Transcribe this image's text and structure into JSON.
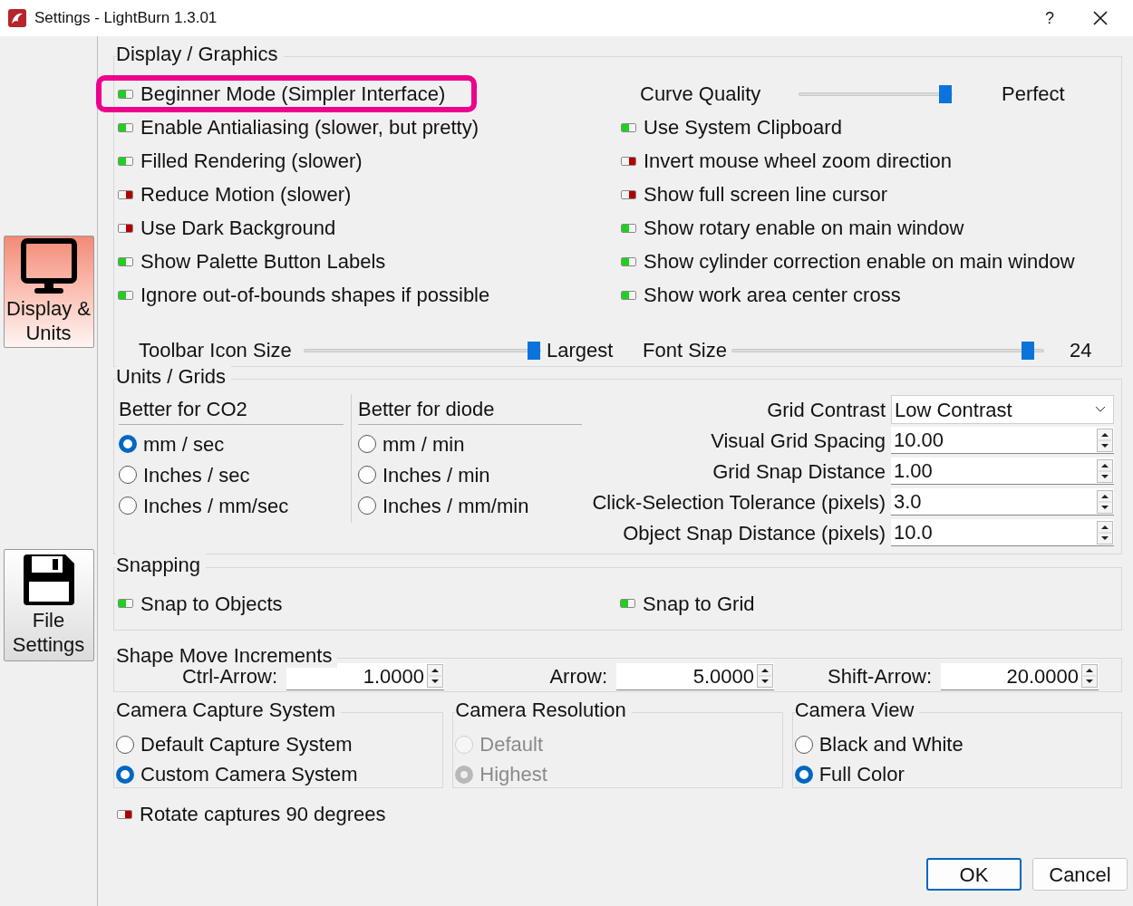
{
  "window": {
    "title": "Settings - LightBurn 1.3.01",
    "help": "?"
  },
  "sidebar": [
    {
      "label": "Display & Units",
      "selected": true
    },
    {
      "label": "File Settings",
      "selected": false
    }
  ],
  "display": {
    "title": "Display / Graphics",
    "left_toggles": [
      {
        "label": "Beginner Mode (Simpler Interface)",
        "on": true,
        "highlighted": true
      },
      {
        "label": "Enable Antialiasing (slower, but pretty)",
        "on": true,
        "highlighted": false
      },
      {
        "label": "Filled Rendering (slower)",
        "on": true,
        "highlighted": false
      },
      {
        "label": "Reduce Motion (slower)",
        "on": false,
        "highlighted": false
      },
      {
        "label": "Use Dark Background",
        "on": false,
        "highlighted": false
      },
      {
        "label": "Show Palette Button Labels",
        "on": true,
        "highlighted": false
      },
      {
        "label": "Ignore out-of-bounds shapes if possible",
        "on": true,
        "highlighted": false
      }
    ],
    "curve_quality": {
      "label": "Curve Quality",
      "level": 1,
      "reading": "Perfect"
    },
    "right_toggles": [
      {
        "label": "Use System Clipboard",
        "on": true
      },
      {
        "label": "Invert mouse wheel zoom direction",
        "on": false
      },
      {
        "label": "Show full screen line cursor",
        "on": false
      },
      {
        "label": "Show rotary enable on main window",
        "on": true
      },
      {
        "label": "Show cylinder correction enable on main window",
        "on": true
      },
      {
        "label": "Show work area center cross",
        "on": true
      }
    ],
    "toolbar_icon_size": {
      "label": "Toolbar Icon Size",
      "level": 1,
      "reading": "Largest"
    },
    "font_size": {
      "label": "Font Size",
      "level": 0.97,
      "reading": "24"
    }
  },
  "units": {
    "title": "Units / Grids",
    "groups": [
      {
        "title": "Better for CO2",
        "options": [
          {
            "label": "mm / sec",
            "selected": true
          },
          {
            "label": "Inches / sec",
            "selected": false
          },
          {
            "label": "Inches / mm/sec",
            "selected": false
          }
        ]
      },
      {
        "title": "Better for diode",
        "options": [
          {
            "label": "mm / min",
            "selected": false
          },
          {
            "label": "Inches / min",
            "selected": false
          },
          {
            "label": "Inches / mm/min",
            "selected": false
          }
        ]
      }
    ],
    "fields": [
      {
        "kind": "dropdown",
        "label": "Grid Contrast",
        "value": "Low Contrast"
      },
      {
        "kind": "spin",
        "label": "Visual Grid Spacing",
        "value": "10.00"
      },
      {
        "kind": "spin",
        "label": "Grid Snap Distance",
        "value": "1.00"
      },
      {
        "kind": "spin",
        "label": "Click-Selection Tolerance (pixels)",
        "value": "3.0"
      },
      {
        "kind": "spin",
        "label": "Object Snap Distance (pixels)",
        "value": "10.0"
      }
    ]
  },
  "snapping": {
    "title": "Snapping",
    "toggles": [
      {
        "label": "Snap to Objects",
        "on": true
      },
      {
        "label": "Snap to Grid",
        "on": true
      }
    ]
  },
  "shape_move": {
    "title": "Shape Move Increments",
    "fields": [
      {
        "label": "Ctrl-Arrow:",
        "value": "1.0000"
      },
      {
        "label": "Arrow:",
        "value": "5.0000"
      },
      {
        "label": "Shift-Arrow:",
        "value": "20.0000"
      }
    ]
  },
  "camera": [
    {
      "title": "Camera Capture System",
      "disabled": false,
      "options": [
        {
          "label": "Default Capture System",
          "selected": false
        },
        {
          "label": "Custom Camera System",
          "selected": true
        }
      ]
    },
    {
      "title": "Camera Resolution",
      "disabled": true,
      "options": [
        {
          "label": "Default",
          "selected": false
        },
        {
          "label": "Highest",
          "selected": true
        }
      ]
    },
    {
      "title": "Camera View",
      "disabled": false,
      "options": [
        {
          "label": "Black and White",
          "selected": false
        },
        {
          "label": "Full Color",
          "selected": true
        }
      ]
    }
  ],
  "rotate_captures": {
    "label": "Rotate captures 90 degrees",
    "on": false
  },
  "buttons": [
    {
      "label": "OK",
      "default": true
    },
    {
      "label": "Cancel",
      "default": false
    }
  ]
}
